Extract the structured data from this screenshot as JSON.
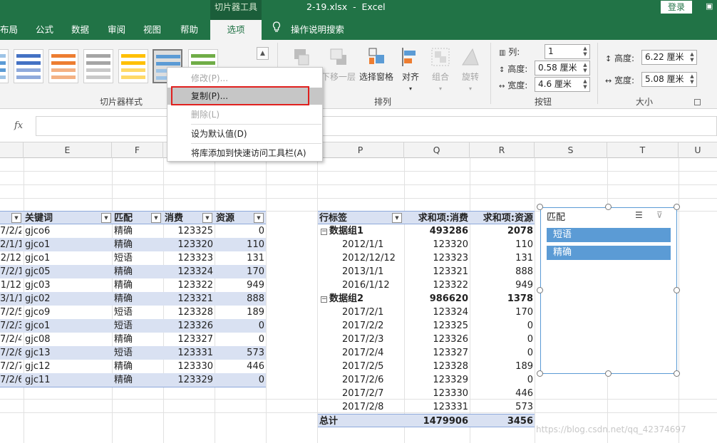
{
  "titlebar": {
    "tool_tab_header": "切片器工具",
    "filename": "2-19.xlsx",
    "app": "Excel",
    "login": "登录"
  },
  "tabs": [
    "布局",
    "公式",
    "数据",
    "审阅",
    "视图",
    "帮助",
    "选项"
  ],
  "active_tab": "选项",
  "tell_me": "操作说明搜索",
  "ribbon": {
    "groups": {
      "styles": "切片器样式",
      "arrange": "排列",
      "buttons": "按钮",
      "size": "大小"
    },
    "arrange_buttons": {
      "bring_forward": "",
      "send_backward": "下移一层",
      "selection_pane": "选择窗格",
      "align": "对齐",
      "group": "组合",
      "rotate": "旋转"
    },
    "buttons_group": {
      "columns_label": "列:",
      "columns_value": "1",
      "height_label": "高度:",
      "height_value": "0.58 厘米",
      "width_label": "宽度:",
      "width_value": "4.6 厘米"
    },
    "size_group": {
      "height_label": "高度:",
      "height_value": "6.22 厘米",
      "width_label": "宽度:",
      "width_value": "5.08 厘米"
    }
  },
  "formula_bar": {
    "fx": "fx",
    "content": ""
  },
  "columns": [
    "E",
    "F",
    "G",
    "P",
    "Q",
    "R",
    "S",
    "T",
    "U"
  ],
  "context_menu": {
    "items": [
      {
        "label": "修改(P)...",
        "disabled": true
      },
      {
        "label": "复制(P)...",
        "disabled": false,
        "highlighted": true
      },
      {
        "label": "删除(L)",
        "disabled": true
      },
      {
        "label": "设为默认值(D)",
        "disabled": false
      },
      {
        "label": "将库添加到快速访问工具栏(A)",
        "disabled": false
      }
    ]
  },
  "data_table": {
    "headers": [
      "",
      "关键词",
      "匹配",
      "消费",
      "资源"
    ],
    "rows": [
      [
        "7/2/2",
        "gjco6",
        "精确",
        "123325",
        "0"
      ],
      [
        "2/1/1",
        "gjco1",
        "精确",
        "123320",
        "110"
      ],
      [
        "2/12",
        "gjco1",
        "短语",
        "123323",
        "131"
      ],
      [
        "7/2/1",
        "gjc05",
        "精确",
        "123324",
        "170"
      ],
      [
        "1/12",
        "gjc03",
        "精确",
        "123322",
        "949"
      ],
      [
        "3/1/1",
        "gjc02",
        "精确",
        "123321",
        "888"
      ],
      [
        "7/2/5",
        "gjco9",
        "短语",
        "123328",
        "189"
      ],
      [
        "7/2/3",
        "gjco1",
        "短语",
        "123326",
        "0"
      ],
      [
        "7/2/4",
        "gjc08",
        "精确",
        "123327",
        "0"
      ],
      [
        "7/2/8",
        "gjc13",
        "短语",
        "123331",
        "573"
      ],
      [
        "7/2/7",
        "gjc12",
        "精确",
        "123330",
        "446"
      ],
      [
        "7/2/6",
        "gjc11",
        "精确",
        "123329",
        "0"
      ]
    ]
  },
  "pivot": {
    "headers": [
      "行标签",
      "求和项:消费",
      "求和项:资源"
    ],
    "rows": [
      {
        "label": "数据组1",
        "v1": "493286",
        "v2": "2078",
        "group": true
      },
      {
        "label": "2012/1/1",
        "v1": "123320",
        "v2": "110"
      },
      {
        "label": "2012/12/12",
        "v1": "123323",
        "v2": "131"
      },
      {
        "label": "2013/1/1",
        "v1": "123321",
        "v2": "888"
      },
      {
        "label": "2016/1/12",
        "v1": "123322",
        "v2": "949"
      },
      {
        "label": "数据组2",
        "v1": "986620",
        "v2": "1378",
        "group": true
      },
      {
        "label": "2017/2/1",
        "v1": "123324",
        "v2": "170"
      },
      {
        "label": "2017/2/2",
        "v1": "123325",
        "v2": "0"
      },
      {
        "label": "2017/2/3",
        "v1": "123326",
        "v2": "0"
      },
      {
        "label": "2017/2/4",
        "v1": "123327",
        "v2": "0"
      },
      {
        "label": "2017/2/5",
        "v1": "123328",
        "v2": "189"
      },
      {
        "label": "2017/2/6",
        "v1": "123329",
        "v2": "0"
      },
      {
        "label": "2017/2/7",
        "v1": "123330",
        "v2": "446"
      },
      {
        "label": "2017/2/8",
        "v1": "123331",
        "v2": "573"
      }
    ],
    "total": {
      "label": "总计",
      "v1": "1479906",
      "v2": "3456"
    }
  },
  "slicer": {
    "title": "匹配",
    "items": [
      "短语",
      "精确"
    ]
  },
  "watermark": "https://blog.csdn.net/qq_42374697",
  "colors": {
    "excel_green": "#217346",
    "table_band": "#d9e1f2",
    "slicer_item": "#5b9bd5",
    "highlight_box": "#e0201e"
  }
}
